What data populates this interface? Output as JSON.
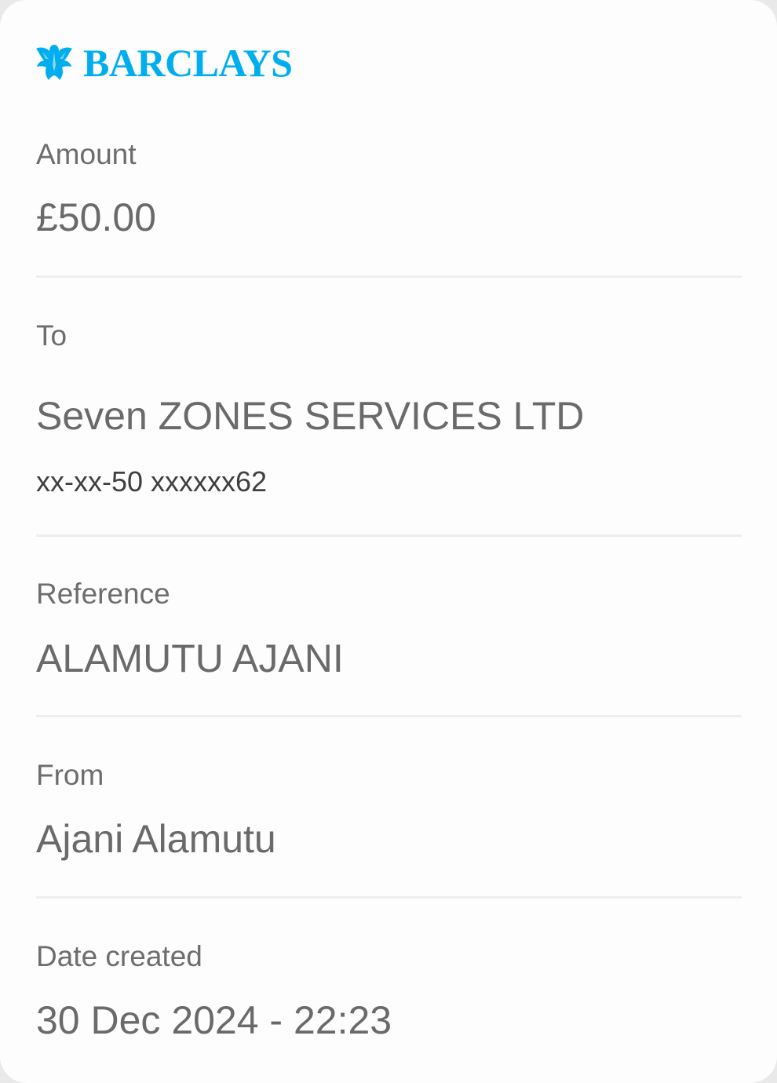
{
  "brand": {
    "name": "BARCLAYS",
    "icon": "eagle-icon",
    "color": "#00AEEF"
  },
  "amount": {
    "label": "Amount",
    "value": "£50.00"
  },
  "to": {
    "label": "To",
    "name": "Seven ZONES SERVICES LTD",
    "account": "xx-xx-50 xxxxxx62"
  },
  "reference": {
    "label": "Reference",
    "value": "ALAMUTU AJANI"
  },
  "from": {
    "label": "From",
    "value": "Ajani Alamutu"
  },
  "date_created": {
    "label": "Date created",
    "value": "30 Dec 2024 - 22:23"
  }
}
